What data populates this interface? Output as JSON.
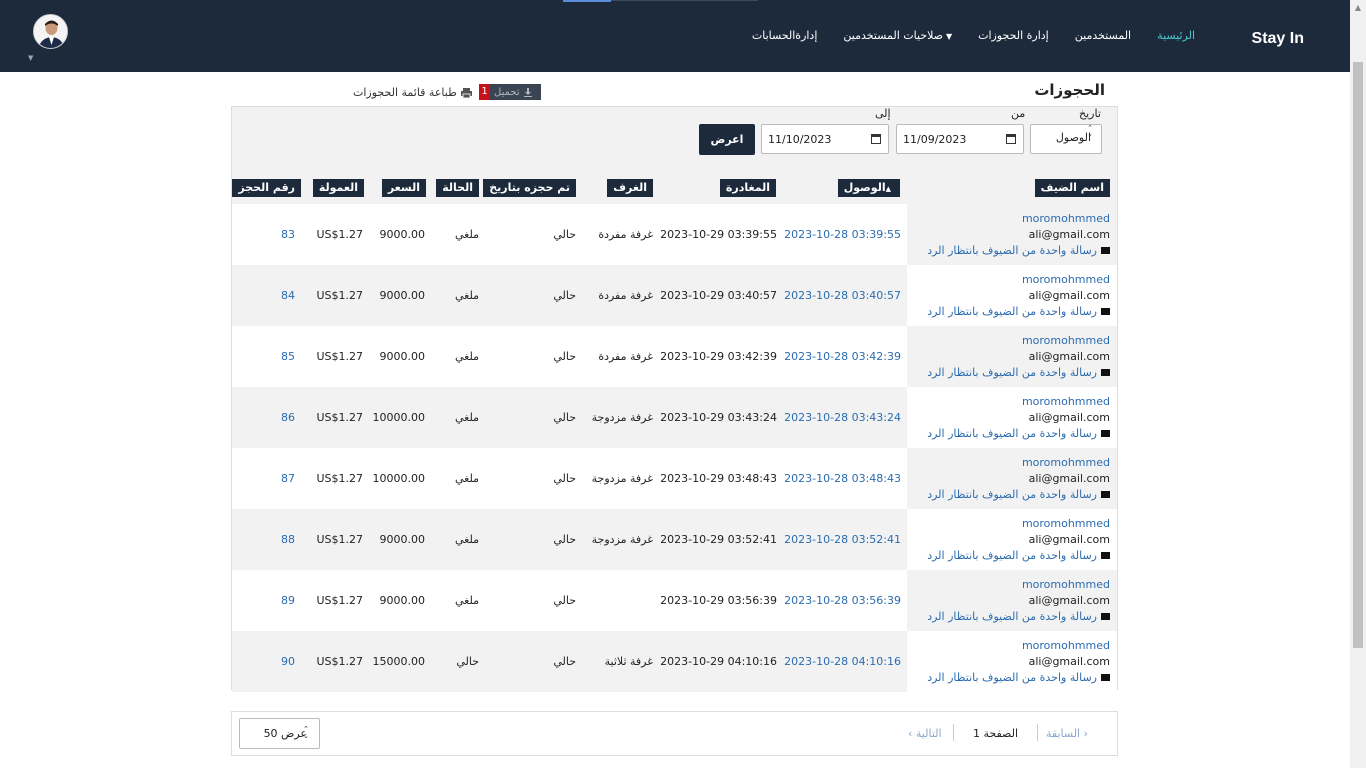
{
  "nav": {
    "brand": "Stay In",
    "links": [
      {
        "label": "الرئيسية",
        "active": true
      },
      {
        "label": "المستخدمين",
        "active": false
      },
      {
        "label": "إدارة الحجوزات",
        "active": false
      },
      {
        "label": "صلاحيات المستخدمين",
        "active": false,
        "dropdown": true
      },
      {
        "label": "إدارةالحسابات",
        "active": false
      }
    ]
  },
  "page": {
    "title": "الحجوزات",
    "print_label": "طباعة قائمة الحجوزات",
    "download_label": "تحميل",
    "download_count": "1"
  },
  "filters": {
    "type_label": "تاريخ",
    "from_label": "من",
    "to_label": "إلى",
    "date_type_value": "الوصول",
    "from_value": "11/09/2023",
    "to_value": "11/10/2023",
    "show_label": "اعرض"
  },
  "table": {
    "headers": {
      "guest": "اسم الضيف",
      "arrival": "الوصول",
      "departure": "المغادرة",
      "rooms": "الغرف",
      "booked_on": "تم حجزه بتاريخ",
      "status": "الحالة",
      "price": "السعر",
      "commission": "العمولة",
      "booking_no": "رقم الحجز"
    },
    "rows": [
      {
        "name": "moromohmmed",
        "email": "ali@gmail.com",
        "msg": "رسالة واحدة من الضيوف بانتظار الرد",
        "arrival": "2023-10-28 03:39:55",
        "departure": "2023-10-29 03:39:55",
        "room": "غرفة مفردة",
        "booked_on": "حالي",
        "status": "ملغي",
        "price": "9000.00",
        "commission": "US$1.27",
        "id": "83"
      },
      {
        "name": "moromohmmed",
        "email": "ali@gmail.com",
        "msg": "رسالة واحدة من الضيوف بانتظار الرد",
        "arrival": "2023-10-28 03:40:57",
        "departure": "2023-10-29 03:40:57",
        "room": "غرفة مفردة",
        "booked_on": "حالي",
        "status": "ملغي",
        "price": "9000.00",
        "commission": "US$1.27",
        "id": "84"
      },
      {
        "name": "moromohmmed",
        "email": "ali@gmail.com",
        "msg": "رسالة واحدة من الضيوف بانتظار الرد",
        "arrival": "2023-10-28 03:42:39",
        "departure": "2023-10-29 03:42:39",
        "room": "غرفة مفردة",
        "booked_on": "حالي",
        "status": "ملغي",
        "price": "9000.00",
        "commission": "US$1.27",
        "id": "85"
      },
      {
        "name": "moromohmmed",
        "email": "ali@gmail.com",
        "msg": "رسالة واحدة من الضيوف بانتظار الرد",
        "arrival": "2023-10-28 03:43:24",
        "departure": "2023-10-29 03:43:24",
        "room": "غرفة مزدوجة",
        "booked_on": "حالي",
        "status": "ملغي",
        "price": "10000.00",
        "commission": "US$1.27",
        "id": "86"
      },
      {
        "name": "moromohmmed",
        "email": "ali@gmail.com",
        "msg": "رسالة واحدة من الضيوف بانتظار الرد",
        "arrival": "2023-10-28 03:48:43",
        "departure": "2023-10-29 03:48:43",
        "room": "غرفة مزدوجة",
        "booked_on": "حالي",
        "status": "ملغي",
        "price": "10000.00",
        "commission": "US$1.27",
        "id": "87"
      },
      {
        "name": "moromohmmed",
        "email": "ali@gmail.com",
        "msg": "رسالة واحدة من الضيوف بانتظار الرد",
        "arrival": "2023-10-28 03:52:41",
        "departure": "2023-10-29 03:52:41",
        "room": "غرفة مزدوجة",
        "booked_on": "حالي",
        "status": "ملغي",
        "price": "9000.00",
        "commission": "US$1.27",
        "id": "88"
      },
      {
        "name": "moromohmmed",
        "email": "ali@gmail.com",
        "msg": "رسالة واحدة من الضيوف بانتظار الرد",
        "arrival": "2023-10-28 03:56:39",
        "departure": "2023-10-29 03:56:39",
        "room": "",
        "booked_on": "حالي",
        "status": "ملغي",
        "price": "9000.00",
        "commission": "US$1.27",
        "id": "89"
      },
      {
        "name": "moromohmmed",
        "email": "ali@gmail.com",
        "msg": "رسالة واحدة من الضيوف بانتظار الرد",
        "arrival": "2023-10-28 04:10:16",
        "departure": "2023-10-29 04:10:16",
        "room": "غرفة ثلاثية",
        "booked_on": "حالي",
        "status": "حالي",
        "price": "15000.00",
        "commission": "US$1.27",
        "id": "90"
      }
    ]
  },
  "pagination": {
    "prev": "السابقة",
    "page_label": "الصفحة 1",
    "next": "التالية",
    "per_page": "عرض 50"
  },
  "colors": {
    "navbar": "#1d2a3c",
    "active_link": "#49c6c9",
    "link": "#2b6cb0",
    "badge": "#c6101a"
  }
}
